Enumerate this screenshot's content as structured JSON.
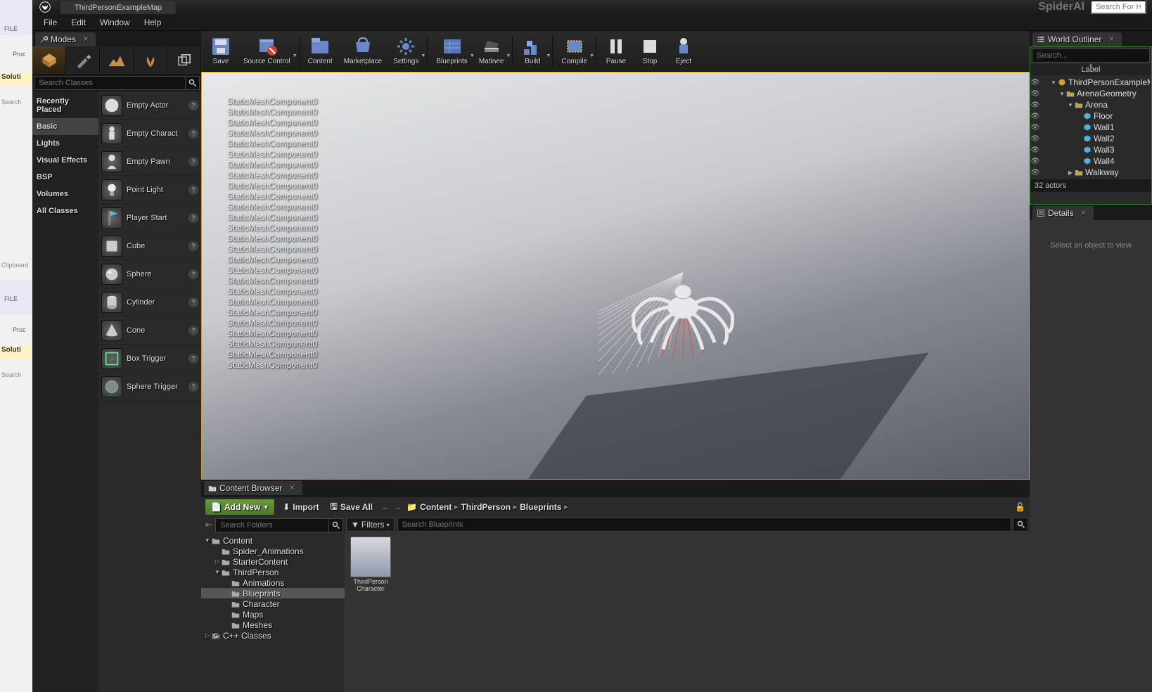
{
  "title": {
    "tab": "ThirdPersonExampleMap",
    "project": "SpiderAI",
    "search_help_placeholder": "Search For Help"
  },
  "menu": {
    "file": "File",
    "edit": "Edit",
    "window": "Window",
    "help": "Help"
  },
  "toolbar": {
    "save": "Save",
    "source_control": "Source Control",
    "content": "Content",
    "marketplace": "Marketplace",
    "settings": "Settings",
    "blueprints": "Blueprints",
    "matinee": "Matinee",
    "build": "Build",
    "compile": "Compile",
    "pause": "Pause",
    "stop": "Stop",
    "eject": "Eject"
  },
  "modes": {
    "tab": "Modes",
    "search_placeholder": "Search Classes",
    "categories": [
      "Recently Placed",
      "Basic",
      "Lights",
      "Visual Effects",
      "BSP",
      "Volumes",
      "All Classes"
    ],
    "selected_category": 1,
    "actors": [
      "Empty Actor",
      "Empty Charact",
      "Empty Pawn",
      "Point Light",
      "Player Start",
      "Cube",
      "Sphere",
      "Cylinder",
      "Cone",
      "Box Trigger",
      "Sphere Trigger"
    ]
  },
  "viewport": {
    "debug_text": "StaticMeshComponent0",
    "debug_count": 26
  },
  "outliner": {
    "tab": "World Outliner",
    "search_placeholder": "Search...",
    "header": "Label",
    "tree": [
      {
        "indent": 0,
        "label": "ThirdPersonExampleMap",
        "type": "world",
        "exp": "▼"
      },
      {
        "indent": 1,
        "label": "ArenaGeometry",
        "type": "folder",
        "exp": "▼"
      },
      {
        "indent": 2,
        "label": "Arena",
        "type": "folder",
        "exp": "▼"
      },
      {
        "indent": 3,
        "label": "Floor",
        "type": "mesh"
      },
      {
        "indent": 3,
        "label": "Wall1",
        "type": "mesh"
      },
      {
        "indent": 3,
        "label": "Wall2",
        "type": "mesh"
      },
      {
        "indent": 3,
        "label": "Wall3",
        "type": "mesh"
      },
      {
        "indent": 3,
        "label": "Wall4",
        "type": "mesh"
      },
      {
        "indent": 2,
        "label": "Walkway",
        "type": "folder",
        "exp": "▶"
      }
    ],
    "count": "32 actors"
  },
  "details": {
    "tab": "Details",
    "placeholder": "Select an object to view"
  },
  "content_browser": {
    "tab": "Content Browser",
    "add_new": "Add New",
    "import": "Import",
    "save_all": "Save All",
    "breadcrumb": [
      "Content",
      "ThirdPerson",
      "Blueprints"
    ],
    "filters": "Filters",
    "search_folders_placeholder": "Search Folders",
    "search_assets_placeholder": "Search Blueprints",
    "tree": [
      {
        "indent": 0,
        "label": "Content",
        "exp": "▼"
      },
      {
        "indent": 1,
        "label": "Spider_Animations"
      },
      {
        "indent": 1,
        "label": "StarterContent",
        "exp": "▷"
      },
      {
        "indent": 1,
        "label": "ThirdPerson",
        "exp": "▼"
      },
      {
        "indent": 2,
        "label": "Animations"
      },
      {
        "indent": 2,
        "label": "Blueprints",
        "sel": true
      },
      {
        "indent": 2,
        "label": "Character"
      },
      {
        "indent": 2,
        "label": "Maps"
      },
      {
        "indent": 2,
        "label": "Meshes"
      },
      {
        "indent": 0,
        "label": "C++ Classes",
        "exp": "▷",
        "cpp": true
      }
    ],
    "assets": [
      {
        "name": "ThirdPerson Character"
      }
    ]
  },
  "bg_left": {
    "file_tab": "FILE",
    "proc": "Proc",
    "solut": "Soluti",
    "search": "Search",
    "clipboard": "Clipboard"
  }
}
